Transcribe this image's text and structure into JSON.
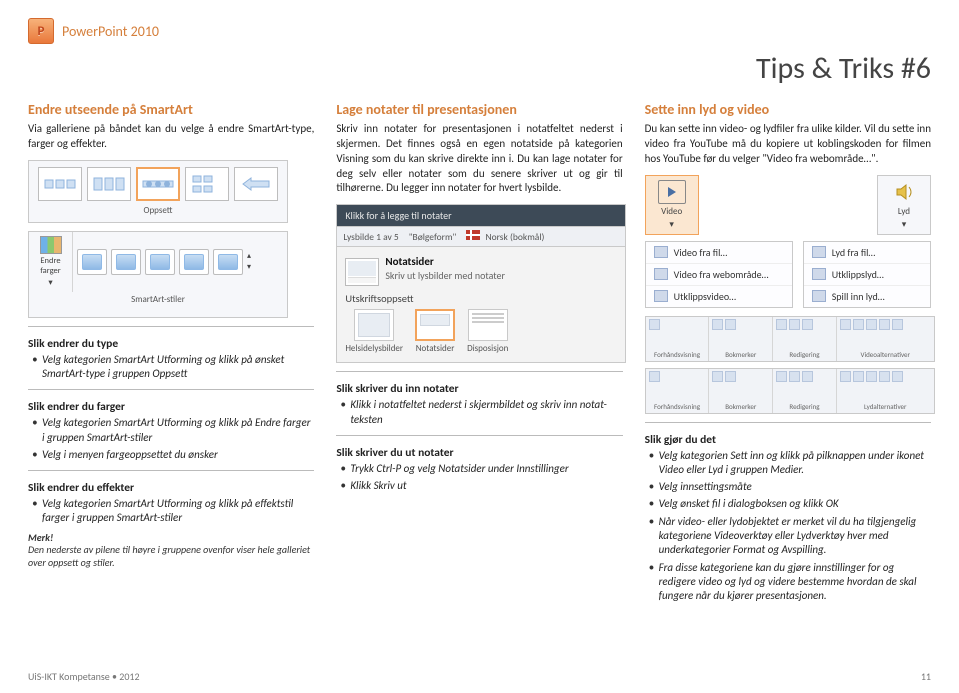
{
  "app_title": "PowerPoint 2010",
  "page_title": "Tips & Triks #6",
  "col1": {
    "h": "Endre utseende på SmartArt",
    "p": "Via galleriene på båndet kan du velge å endre SmartArt-type, farger og effekter.",
    "gallery_caption": "Oppsett",
    "endre_farger_label": "Endre farger",
    "styles_label": "SmartArt-stiler",
    "type_h": "Slik endrer du type",
    "type_b1": "Velg kategorien SmartArt Utforming og klikk på ønsket SmartArt-type i gruppen Oppsett",
    "farger_h": "Slik endrer du farger",
    "farger_b1": "Velg kategorien SmartArt Utforming og klikk på Endre farger i gruppen SmartArt-stiler",
    "farger_b2": "Velg i menyen fargeoppsettet du ønsker",
    "effekter_h": "Slik endrer du effekter",
    "effekter_b1": "Velg kategorien SmartArt Utforming og klikk på effektstil farger i gruppen SmartArt-stiler",
    "merk_label": "Merk!",
    "merk_text": "Den nederste av pilene til høyre i gruppene ovenfor viser hele galleriet over oppsett og stiler."
  },
  "col2": {
    "h": "Lage notater til presentasjonen",
    "p": "Skriv inn notater for presentasjonen i notatfeltet nederst i skjermen. Det finnes også en egen notatside på kategorien Visning som du kan skrive direkte inn i. Du kan lage notater for deg selv eller notater som du senere skriver ut og gir til tilhørerne. Du legger inn notater for hvert lysbilde.",
    "notes_placeholder": "Klikk for å legge til notater",
    "status_slide": "Lysbilde 1 av 5",
    "status_theme": "\"Bølgeform\"",
    "status_lang": "Norsk (bokmål)",
    "print_h": "Notatsider",
    "print_sub": "Skriv ut lysbilder med notater",
    "print_line": "Utskriftsoppsett",
    "opt1": "Helsidelysbilder",
    "opt2": "Notatsider",
    "opt3": "Disposisjon",
    "inn_h": "Slik skriver du inn notater",
    "inn_b1": "Klikk i notatfeltet nederst i skjermbildet og skriv inn notat-teksten",
    "ut_h": "Slik skriver du ut notater",
    "ut_b1": "Trykk Ctrl-P og velg Notatsider under Innstillinger",
    "ut_b2": "Klikk Skriv ut"
  },
  "col3": {
    "h": "Sette inn lyd og video",
    "p": "Du kan sette inn video- og lydfiler fra ulike kilder. Vil du sette inn video fra YouTube må du kopiere ut koblingskoden for filmen hos YouTube før du velger \"Video fra webområde…\".",
    "btn_video": "Video",
    "btn_lyd": "Lyd",
    "vmenu": [
      "Video fra fil…",
      "Video fra webområde…",
      "Utklippsvideo…"
    ],
    "lmenu": [
      "Lyd fra fil…",
      "Utklippslyd…",
      "Spill inn lyd…"
    ],
    "ribbon_groups": [
      "Forhåndsvisning",
      "Bokmerker",
      "Redigering",
      "Videoalternativer"
    ],
    "ribbon2_groups": [
      "Forhåndsvisning",
      "Bokmerker",
      "Redigering",
      "Lydalternativer"
    ],
    "det_h": "Slik gjør du det",
    "det_b1": "Velg kategorien Sett inn og klikk på pilknappen under ikonet Video eller Lyd i gruppen Medier.",
    "det_b2": "Velg innsettingsmåte",
    "det_b3": "Velg ønsket fil i dialogboksen og klikk OK",
    "det_b4": "Når video- eller lydobjektet er merket vil du ha tilgjengelig kategoriene Videoverktøy eller Lydverktøy hver med underkategorier Format og Avspilling.",
    "det_b5": "Fra disse kategoriene kan du gjøre innstillinger for og redigere video og lyd og videre bestemme hvordan de skal fungere når du kjører presentasjonen."
  },
  "footer_left": "UiS-IKT Kompetanse • 2012",
  "footer_right": "11"
}
